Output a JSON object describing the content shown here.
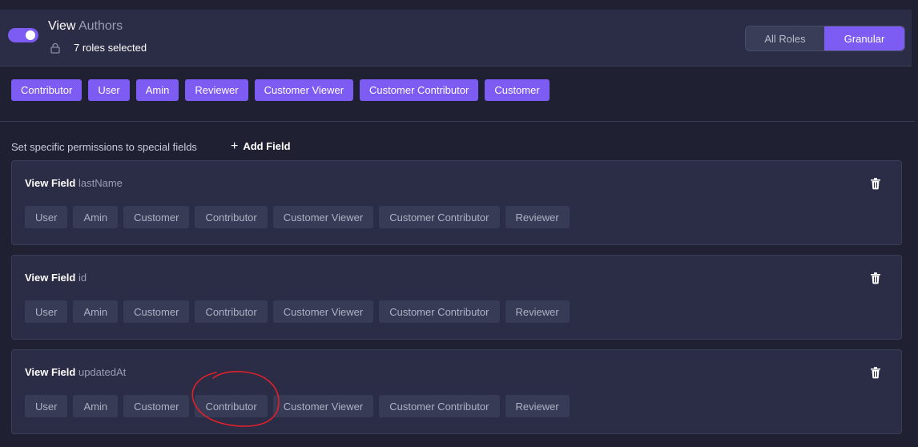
{
  "header": {
    "title_strong": "View",
    "title_muted": "Authors",
    "roles_selected": "7 roles selected",
    "toggle_on": true,
    "mode": {
      "all_roles_label": "All Roles",
      "granular_label": "Granular",
      "selected": "Granular"
    }
  },
  "selected_roles": [
    "Contributor",
    "User",
    "Amin",
    "Reviewer",
    "Customer Viewer",
    "Customer Contributor",
    "Customer"
  ],
  "special": {
    "text": "Set specific permissions to special fields",
    "add_label": "Add Field"
  },
  "fields": [
    {
      "prefix": "View Field",
      "name": "lastName",
      "roles": [
        "User",
        "Amin",
        "Customer",
        "Contributor",
        "Customer Viewer",
        "Customer Contributor",
        "Reviewer"
      ]
    },
    {
      "prefix": "View Field",
      "name": "id",
      "roles": [
        "User",
        "Amin",
        "Customer",
        "Contributor",
        "Customer Viewer",
        "Customer Contributor",
        "Reviewer"
      ]
    },
    {
      "prefix": "View Field",
      "name": "updatedAt",
      "roles": [
        "User",
        "Amin",
        "Customer",
        "Contributor",
        "Customer Viewer",
        "Customer Contributor",
        "Reviewer"
      ]
    }
  ],
  "colors": {
    "accent": "#7c5cf2",
    "background": "#1f2133",
    "panel": "#2a2d45",
    "annotation": "#e0202a"
  },
  "icons": {
    "lock": "lock-icon",
    "plus": "plus-icon",
    "trash": "trash-icon"
  }
}
